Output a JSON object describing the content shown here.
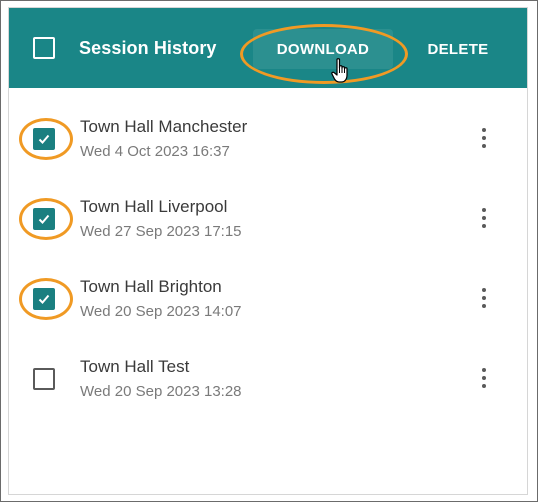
{
  "header": {
    "title": "Session History",
    "select_all_checked": false,
    "download_label": "DOWNLOAD",
    "delete_label": "DELETE"
  },
  "sessions": [
    {
      "title": "Town Hall Manchester",
      "date": "Wed 4 Oct 2023 16:37",
      "checked": true
    },
    {
      "title": "Town Hall Liverpool",
      "date": "Wed 27 Sep 2023 17:15",
      "checked": true
    },
    {
      "title": "Town Hall Brighton",
      "date": "Wed 20 Sep 2023 14:07",
      "checked": true
    },
    {
      "title": "Town Hall Test",
      "date": "Wed 20 Sep 2023 13:28",
      "checked": false
    }
  ],
  "colors": {
    "toolbar": "#1a8687",
    "checkbox_checked": "#1a7f80",
    "highlight": "#f09a24"
  },
  "icons": {
    "row_menu": "kebab-menu-icon",
    "checkmark": "checkmark-icon",
    "cursor": "hand-pointer-icon"
  }
}
